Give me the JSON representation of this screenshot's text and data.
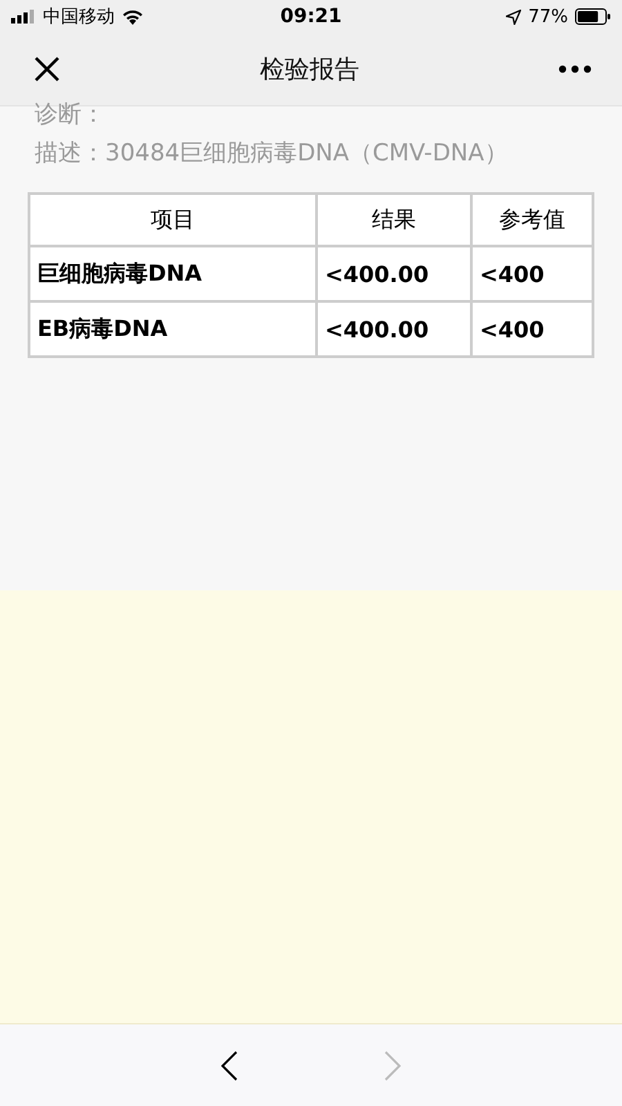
{
  "status_bar": {
    "carrier": "中国移动",
    "time": "09:21",
    "battery": "77%"
  },
  "nav": {
    "title": "检验报告"
  },
  "fields": [
    {
      "label": "诊断："
    },
    {
      "label": "描述：",
      "value": "30484巨细胞病毒DNA（CMV-DNA）"
    }
  ],
  "table": {
    "columns": [
      "项目",
      "结果",
      "参考值"
    ],
    "rows": [
      [
        "巨细胞病毒DNA",
        "<400.00",
        "<400"
      ],
      [
        "EB病毒DNA",
        "<400.00",
        "<400"
      ]
    ]
  },
  "toolbar": {
    "back": {
      "disabled": false
    },
    "forward": {
      "disabled": true
    }
  }
}
